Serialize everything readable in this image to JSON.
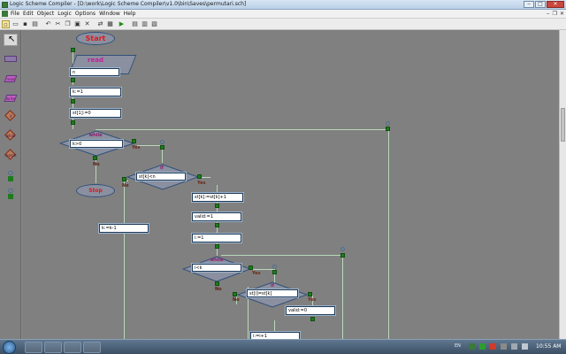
{
  "window": {
    "title": "Logic Scheme Compiler - [D:\\work\\Logic Scheme Compiler\\v1.0\\bin\\Saves\\permutari.sch]"
  },
  "menu": [
    "File",
    "Edit",
    "Object",
    "Logic",
    "Options",
    "Window",
    "Help"
  ],
  "palette": [
    {
      "name": "palette-pointer",
      "label": ""
    },
    {
      "name": "palette-process-block",
      "label": ""
    },
    {
      "name": "palette-read-block",
      "label": "read"
    },
    {
      "name": "palette-write-block",
      "label": "write"
    },
    {
      "name": "palette-if-block",
      "label": "if"
    },
    {
      "name": "palette-while-block",
      "label": "while"
    },
    {
      "name": "palette-repeat-block",
      "label": "repeat"
    }
  ],
  "flow": {
    "start": "Start",
    "read_title": "read",
    "read_value": "n",
    "assign_k": "k:=1",
    "assign_stk": "st[1]:=0",
    "while1_title": "while",
    "while1_cond": "k>0",
    "yes": "Yes",
    "no": "No",
    "stop": "Stop",
    "if1_title": "if",
    "if1_cond": "st[k]<n",
    "kdec": "k:=k-1",
    "stinc": "st[k]:=st[k]+1",
    "valid1": "valid:=1",
    "i1": "i:=1",
    "while2_title": "while",
    "while2_cond": "i<k",
    "if2_title": "if",
    "if2_cond": "st[i]=st[k]",
    "valid0": "valid:=0",
    "iinc": "i:=i+1"
  },
  "taskbar": {
    "lang": "EN",
    "clock": "10:55 AM"
  },
  "colors": {
    "canvas": "#808080",
    "port": "#1e7b1e",
    "connector": "#b9d8b9",
    "diamond_title": "#8e1a6a",
    "start_text": "#e0171b"
  }
}
